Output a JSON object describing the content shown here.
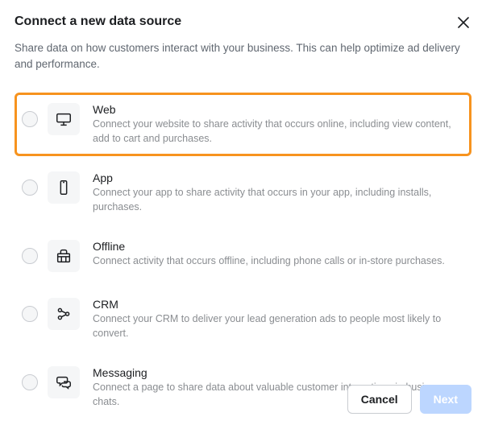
{
  "header": {
    "title": "Connect a new data source",
    "subtitle": "Share data on how customers interact with your business. This can help optimize ad delivery and performance."
  },
  "options": [
    {
      "key": "web",
      "title": "Web",
      "desc": "Connect your website to share activity that occurs online, including view content, add to cart and purchases.",
      "highlight": true
    },
    {
      "key": "app",
      "title": "App",
      "desc": "Connect your app to share activity that occurs in your app, including installs, purchases.",
      "highlight": false
    },
    {
      "key": "offline",
      "title": "Offline",
      "desc": "Connect activity that occurs offline, including phone calls or in-store purchases.",
      "highlight": false
    },
    {
      "key": "crm",
      "title": "CRM",
      "desc": "Connect your CRM to deliver your lead generation ads to people most likely to convert.",
      "highlight": false
    },
    {
      "key": "messaging",
      "title": "Messaging",
      "desc": "Connect a page to share data about valuable customer interactions in business chats.",
      "highlight": false
    }
  ],
  "footer": {
    "cancel": "Cancel",
    "next": "Next"
  }
}
